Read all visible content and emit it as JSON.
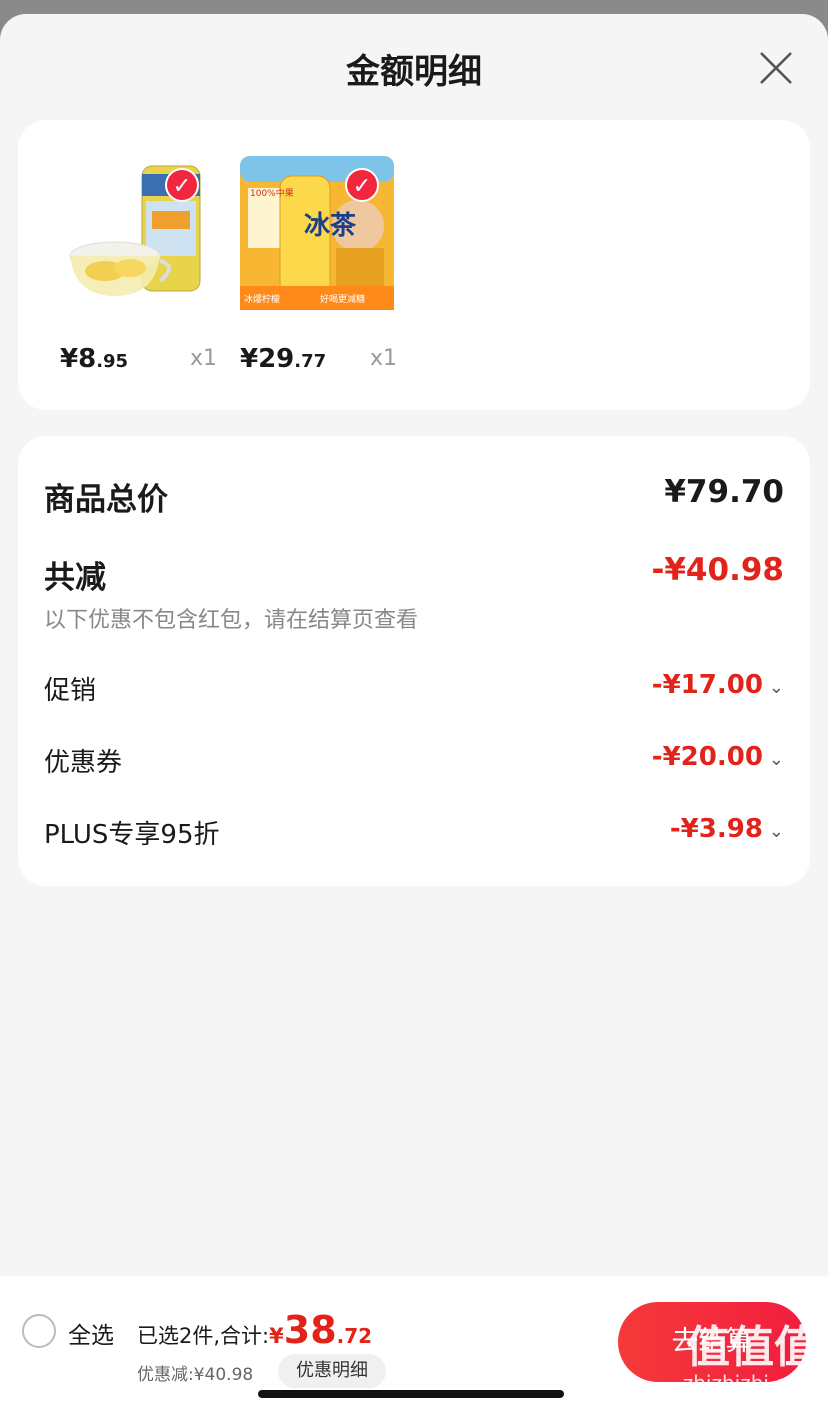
{
  "header": {
    "title": "金额明细"
  },
  "products": [
    {
      "price_int": "¥8",
      "price_dec": ".95",
      "qty": "x1",
      "name": "peach-jar-image"
    },
    {
      "price_int": "¥29",
      "price_dec": ".77",
      "qty": "x1",
      "name": "ice-tea-image"
    }
  ],
  "product_texts": {
    "tea_brand": "冰茶",
    "tea_top": "100%中果",
    "tea_flavor": "冰爆柠檬",
    "tea_slogan": "好喝更减糖"
  },
  "breakdown": {
    "subtotal_label": "商品总价",
    "subtotal_value": "¥79.70",
    "discount_label": "共减",
    "discount_value": "-¥40.98",
    "note": "以下优惠不包含红包，请在结算页查看",
    "items": [
      {
        "label": "促销",
        "value": "-¥17.00"
      },
      {
        "label": "优惠券",
        "value": "-¥20.00"
      },
      {
        "label": "PLUS专享95折",
        "value": "-¥3.98"
      }
    ]
  },
  "bottom": {
    "select_all": "全选",
    "selected_text": "已选2件,合计:",
    "total_yen": "¥",
    "total_int": "38",
    "total_dec": ".72",
    "discount_text": "优惠减:¥40.98",
    "detail_button": "优惠明细",
    "checkout": "去结算"
  },
  "watermark": {
    "logo": "值值值",
    "site": "zhizhizhi.com"
  },
  "colors": {
    "accent": "#e2231a",
    "button": "#f21d3e"
  }
}
